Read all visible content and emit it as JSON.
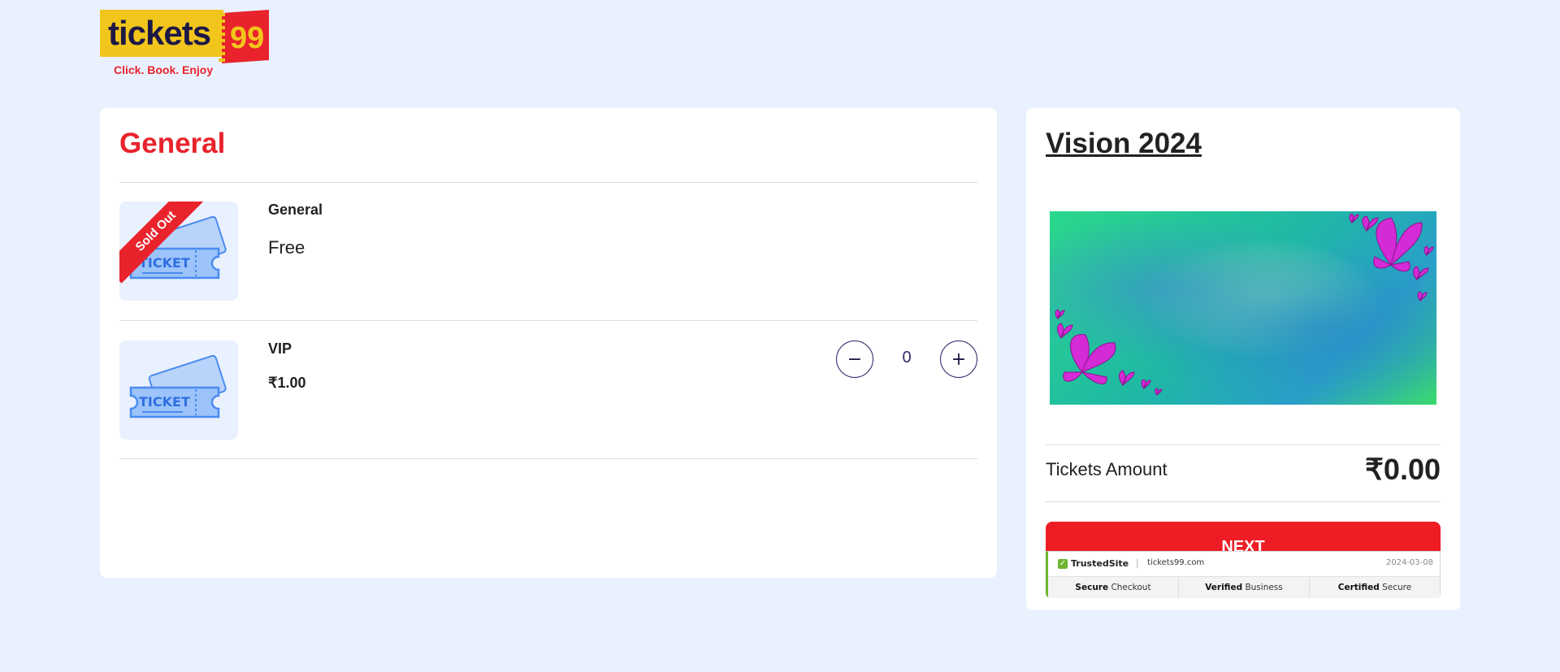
{
  "logo": {
    "word": "tickets",
    "number": "99",
    "tagline": "Click. Book. Enjoy"
  },
  "section": {
    "title": "General"
  },
  "tickets": [
    {
      "name": "General",
      "price": "Free",
      "badge": "Sold Out",
      "image_label": "TICKET"
    },
    {
      "name": "VIP",
      "price": "₹1.00",
      "quantity": "0",
      "minus": "−",
      "plus": "+",
      "image_label": "TICKET"
    }
  ],
  "event": {
    "title": "Vision 2024",
    "amount_label": "Tickets Amount",
    "amount_value": "₹0.00",
    "next_label": "NEXT"
  },
  "trust": {
    "brand": "TrustedSite",
    "separator": "|",
    "domain": "tickets99.com",
    "date": "2024-03-08",
    "badges": [
      {
        "strong": "Secure",
        "rest": " Checkout"
      },
      {
        "strong": "Verified",
        "rest": " Business"
      },
      {
        "strong": "Certified",
        "rest": " Secure"
      }
    ]
  },
  "colors": {
    "brand_red": "#e8232c",
    "brand_yellow": "#f2c51c",
    "brand_navy": "#1d1846",
    "page_bg": "#eaf1fe"
  },
  "icons": [
    "ticket-icon",
    "check-icon",
    "butterfly-icon"
  ]
}
